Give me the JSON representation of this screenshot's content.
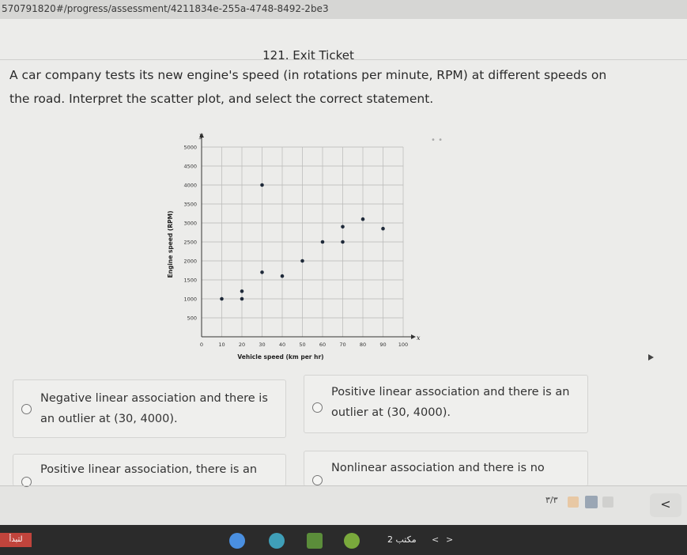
{
  "browser": {
    "url": "570791820#/progress/assessment/4211834e-255a-4748-8492-2be3"
  },
  "header": {
    "title": "121. Exit Ticket"
  },
  "question": {
    "text": "A car company tests its new engine's speed (in rotations per minute, RPM) at different speeds on the road. Interpret the scatter plot, and select the correct statement."
  },
  "chart_data": {
    "type": "scatter",
    "xlabel": "Vehicle speed (km per hr)",
    "ylabel": "Engine speed (RPM)",
    "x_axis_letter": "x",
    "y_axis_letter": "y",
    "xlim": [
      0,
      100
    ],
    "ylim": [
      0,
      5000
    ],
    "x_ticks": [
      0,
      10,
      20,
      30,
      40,
      50,
      60,
      70,
      80,
      90,
      100
    ],
    "y_ticks": [
      500,
      1000,
      1500,
      2000,
      2500,
      3000,
      3500,
      4000,
      4500,
      5000
    ],
    "grid": true,
    "points": [
      {
        "x": 10,
        "y": 1000
      },
      {
        "x": 20,
        "y": 1000
      },
      {
        "x": 20,
        "y": 1200
      },
      {
        "x": 30,
        "y": 4000
      },
      {
        "x": 30,
        "y": 1700
      },
      {
        "x": 40,
        "y": 1600
      },
      {
        "x": 50,
        "y": 2000
      },
      {
        "x": 60,
        "y": 2500
      },
      {
        "x": 70,
        "y": 2500
      },
      {
        "x": 70,
        "y": 2900
      },
      {
        "x": 80,
        "y": 3100
      },
      {
        "x": 90,
        "y": 2850
      }
    ]
  },
  "options": [
    {
      "id": "a",
      "text": "Negative linear association and there is an outlier at (30, 4000)."
    },
    {
      "id": "b",
      "text": "Positive linear association and there is an outlier at (30, 4000)."
    },
    {
      "id": "c",
      "text": "Positive linear association, there is an"
    },
    {
      "id": "d",
      "text": "Nonlinear association and there is no"
    }
  ],
  "footer": {
    "page_indicator": "٣/٣",
    "back_symbol": "<"
  },
  "taskbar": {
    "left_label": "لتبدأ",
    "right_label": "2 مكتب",
    "chev_left": "<",
    "chev_right": ">"
  },
  "colors": {
    "accent_sq_1": "#e8c8a4",
    "accent_sq_2": "#9aa6b4",
    "accent_sq_3": "#d0d0ce"
  }
}
